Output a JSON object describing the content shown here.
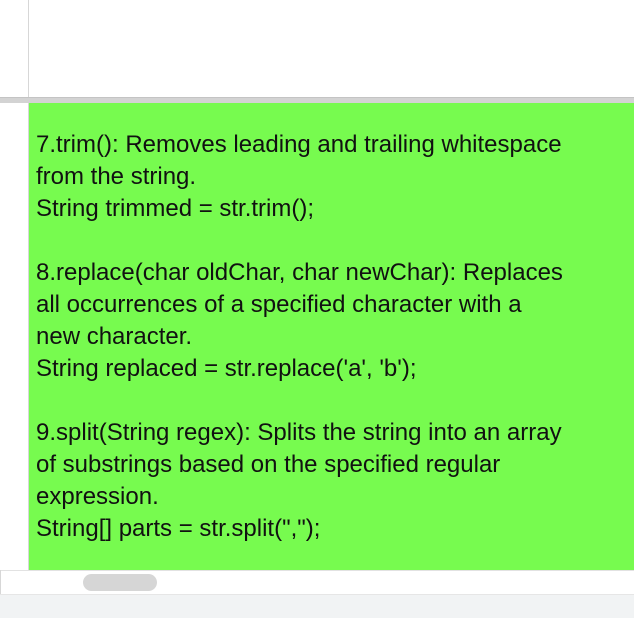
{
  "cell": {
    "lines": [
      "7.trim(): Removes leading and trailing whitespace",
      "from the string.",
      "String trimmed = str.trim();",
      "",
      "8.replace(char oldChar, char newChar): Replaces",
      "all occurrences of a specified character with a",
      "new character.",
      "String replaced = str.replace('a', 'b');",
      "",
      "9.split(String regex): Splits the string into an array",
      "of substrings based on the specified regular",
      "expression.",
      "String[] parts = str.split(\",\");"
    ],
    "background_color": "#77fb4f"
  }
}
